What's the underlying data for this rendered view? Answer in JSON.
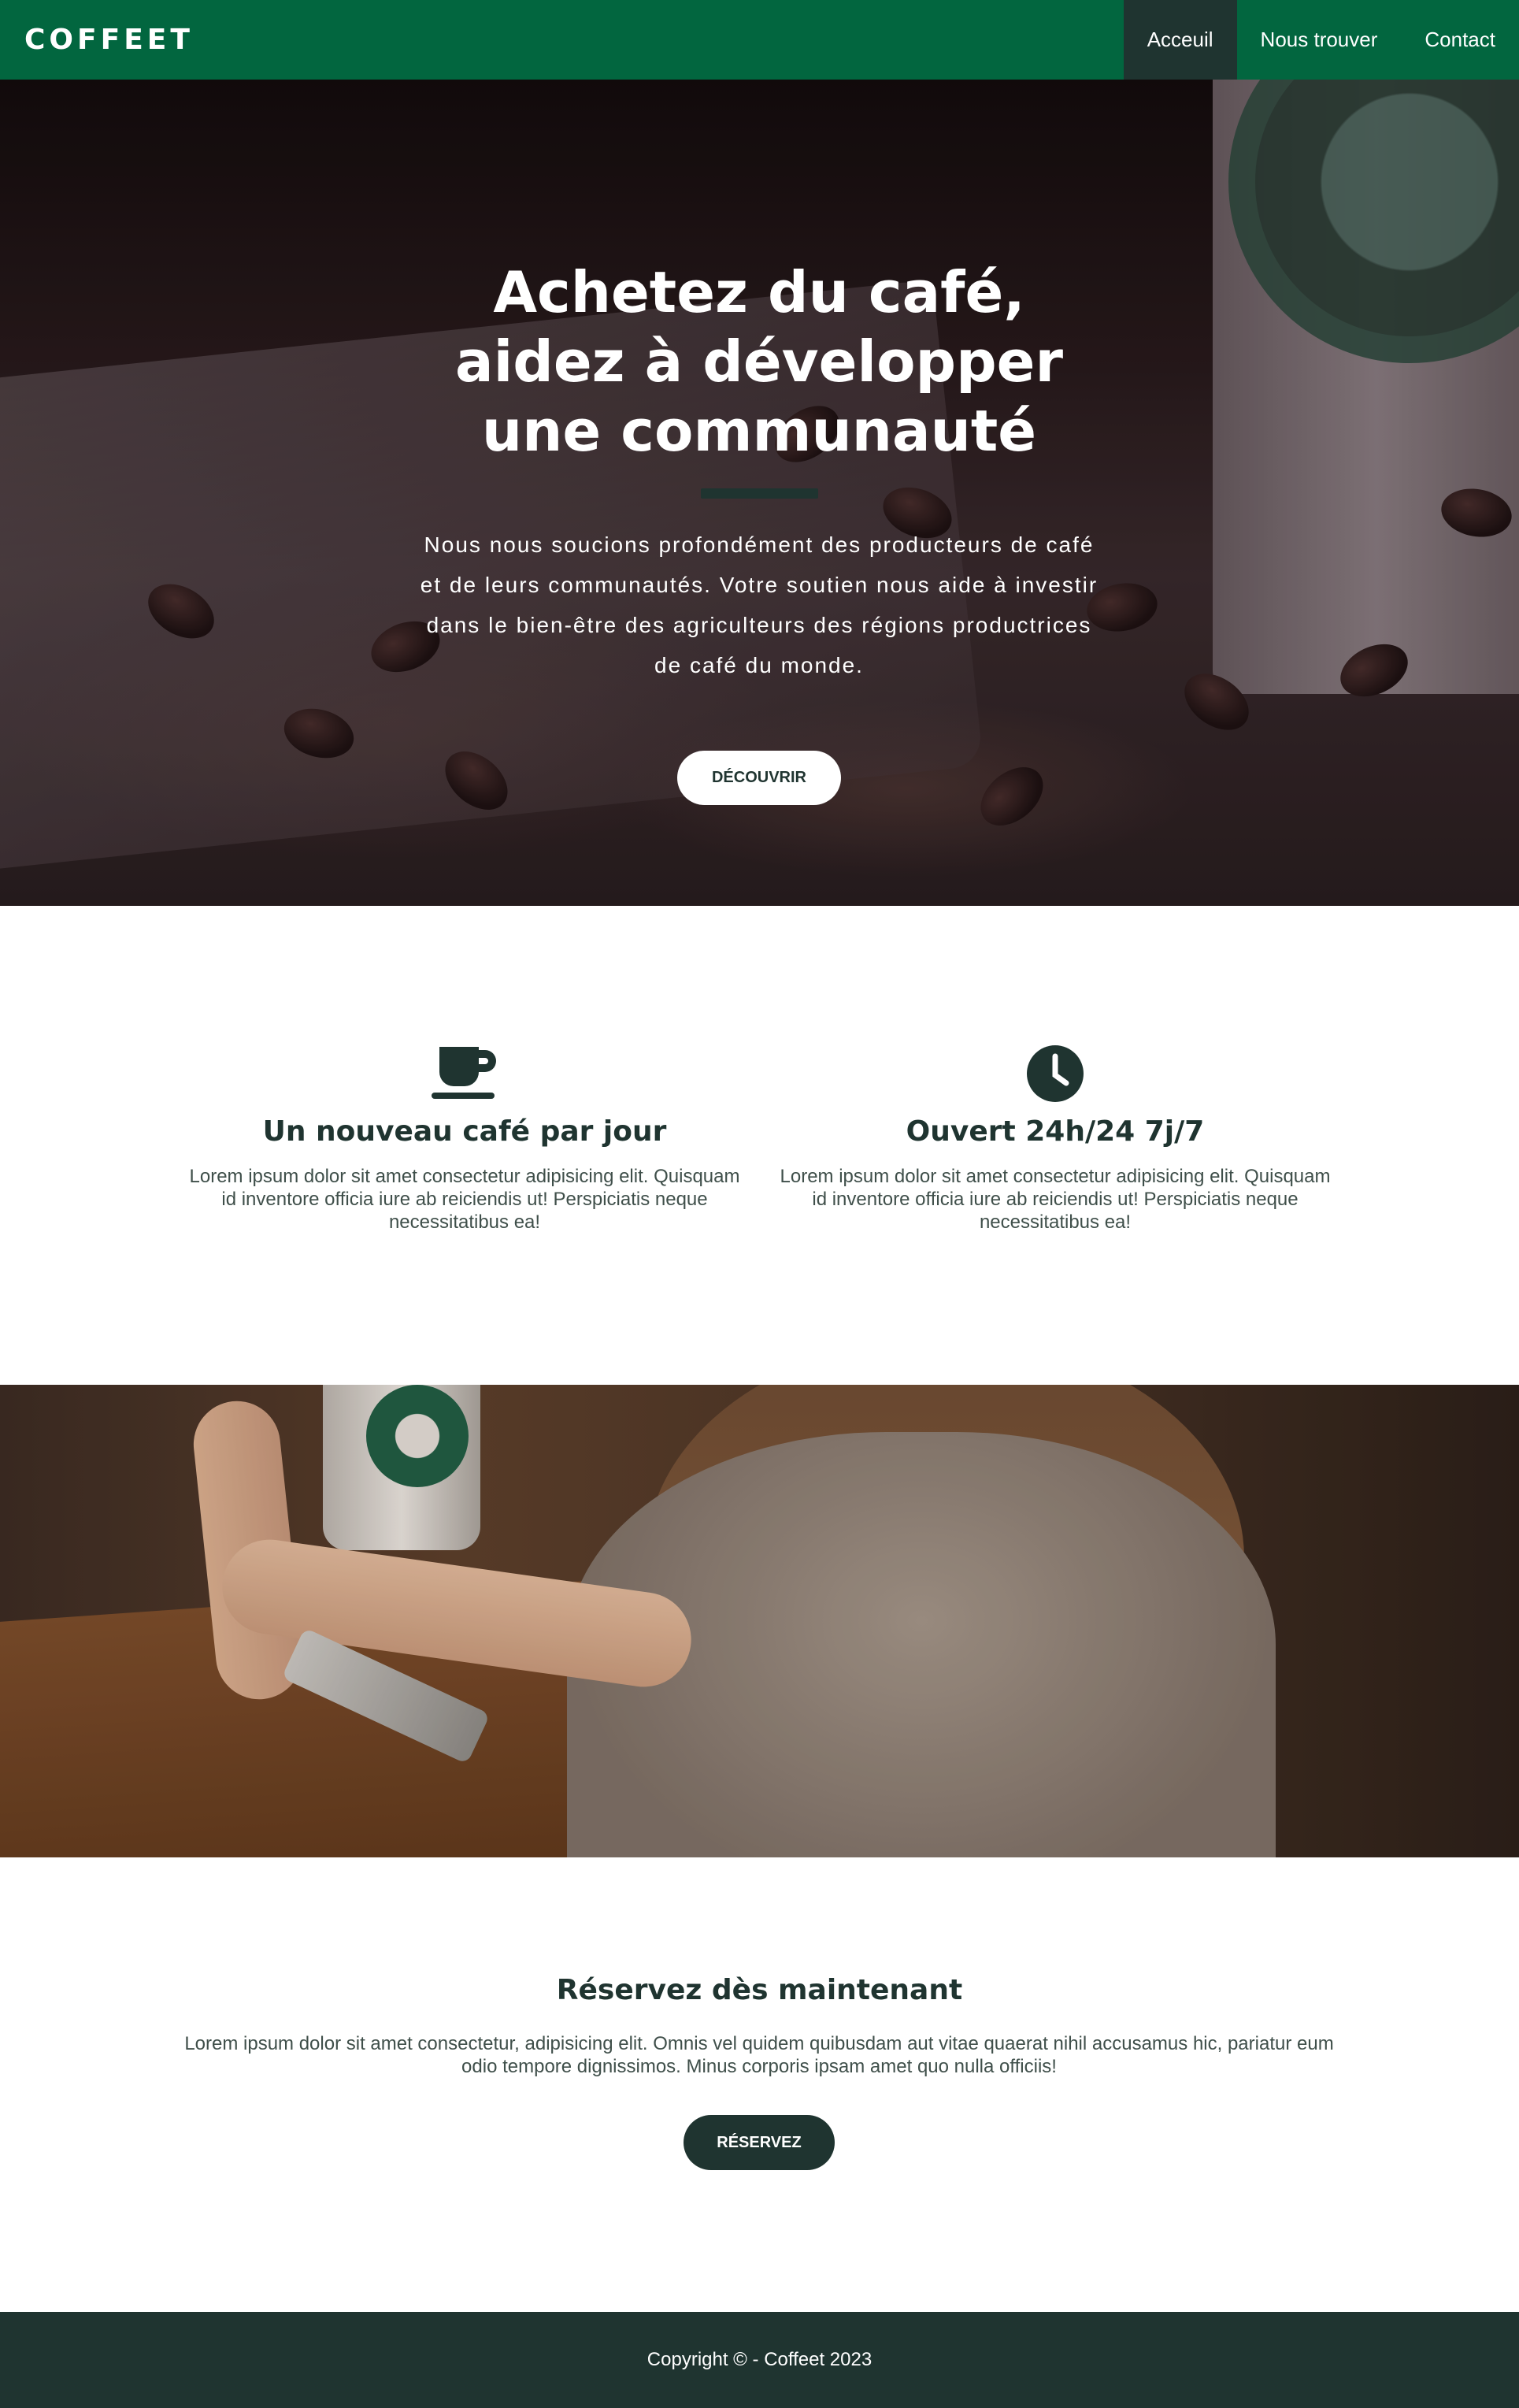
{
  "navbar": {
    "brand": "COFFEET",
    "items": [
      {
        "label": "Acceuil",
        "active": true
      },
      {
        "label": "Nous trouver",
        "active": false
      },
      {
        "label": "Contact",
        "active": false
      }
    ]
  },
  "hero": {
    "title_line1": "Achetez du café,",
    "title_line2": "aidez à développer",
    "title_line3": "une communauté",
    "text": "Nous nous soucions profondément des producteurs de café et de leurs communautés. Votre soutien nous aide à investir dans le bien-être des agriculteurs des régions productrices de café du monde.",
    "button_label": "DÉCOUVRIR",
    "background_icon": "coffee-beans-photo"
  },
  "features": [
    {
      "icon": "coffee-cup-icon",
      "title": "Un nouveau café par jour",
      "text": "Lorem ipsum dolor sit amet consectetur adipisicing elit. Quisquam id inventore officia iure ab reiciendis ut! Perspiciatis neque necessitatibus ea!"
    },
    {
      "icon": "clock-icon",
      "title": "Ouvert 24h/24 7j/7",
      "text": "Lorem ipsum dolor sit amet consectetur adipisicing elit. Quisquam id inventore officia iure ab reiciendis ut! Perspiciatis neque necessitatibus ea!"
    }
  ],
  "reserve": {
    "title": "Réservez dès maintenant",
    "text": "Lorem ipsum dolor sit amet consectetur, adipisicing elit. Omnis vel quidem quibusdam aut vitae quaerat nihil accusamus hic, pariatur eum odio tempore dignissimos. Minus corporis ipsam amet quo nulla officiis!",
    "button_label": "RÉSERVEZ"
  },
  "footer": {
    "copyright": "Copyright © - Coffeet 2023"
  },
  "colors": {
    "brand_green": "#02663f",
    "dark_green": "#1f3430",
    "white": "#ffffff"
  }
}
